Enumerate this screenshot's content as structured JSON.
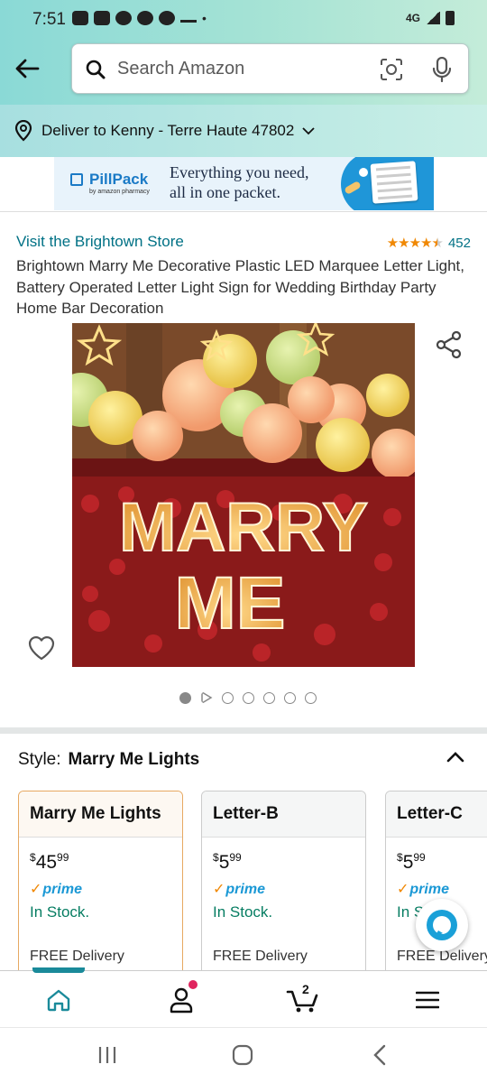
{
  "status_bar": {
    "time": "7:51",
    "network": "4G"
  },
  "search": {
    "placeholder": "Search Amazon"
  },
  "delivery": {
    "text": "Deliver to Kenny - Terre Haute 47802"
  },
  "banner": {
    "brand": "PillPack",
    "brand_sub": "by amazon pharmacy",
    "tagline_line1": "Everything you need,",
    "tagline_line2": "all in one packet."
  },
  "product": {
    "store_link": "Visit the Brightown Store",
    "rating_stars": 4.5,
    "rating_count": "452",
    "title": "Brightown Marry Me Decorative Plastic LED Marquee Letter Light, Battery Operated Letter Light Sign for Wedding Birthday Party Home Bar Decoration",
    "image_text_line1": "MARRY",
    "image_text_line2": "ME",
    "image_count": 7,
    "active_image_index": 0
  },
  "style_selector": {
    "label": "Style:",
    "selected": "Marry Me Lights",
    "options": [
      {
        "name": "Marry Me Lights",
        "price_symbol": "$",
        "price_whole": "45",
        "price_fraction": "99",
        "prime": "prime",
        "stock": "In Stock.",
        "delivery": "FREE Delivery"
      },
      {
        "name": "Letter-B",
        "price_symbol": "$",
        "price_whole": "5",
        "price_fraction": "99",
        "prime": "prime",
        "stock": "In Stock.",
        "delivery": "FREE Delivery"
      },
      {
        "name": "Letter-C",
        "price_symbol": "$",
        "price_whole": "5",
        "price_fraction": "99",
        "prime": "prime",
        "stock": "In Stock.",
        "delivery": "FREE Delivery"
      }
    ]
  },
  "bottom_nav": {
    "cart_count": "2"
  },
  "colors": {
    "link": "#007185",
    "star": "#f08804",
    "prime": "#1a98d5",
    "in_stock": "#067d62",
    "accent": "#1a8a9a"
  }
}
